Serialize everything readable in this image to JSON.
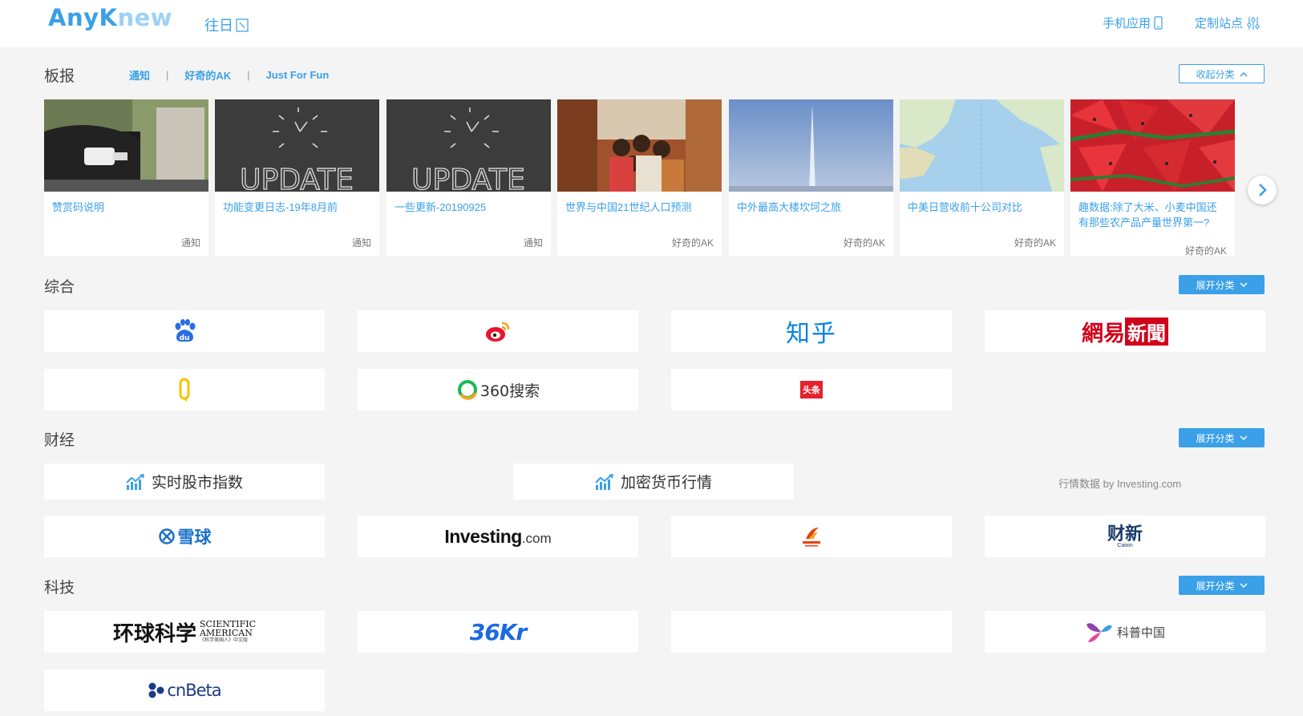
{
  "header": {
    "logo_any": "Any",
    "logo_k": "K",
    "logo_new": "new",
    "history_label": "往日",
    "mobile_label": "手机应用",
    "custom_label": "定制站点"
  },
  "board": {
    "title": "板报",
    "cats": [
      "通知",
      "好奇的AK",
      "Just For Fun"
    ],
    "separator": "|",
    "collapse_label": "收起分类",
    "cards": [
      {
        "title": "赞赏码说明",
        "tag": "通知"
      },
      {
        "title": "功能变更日志-19年8月前",
        "tag": "通知"
      },
      {
        "title": "一些更新-20190925",
        "tag": "通知"
      },
      {
        "title": "世界与中国21世纪人口预测",
        "tag": "好奇的AK"
      },
      {
        "title": "中外最高大楼坎坷之旅",
        "tag": "好奇的AK"
      },
      {
        "title": "中美日营收前十公司对比",
        "tag": "好奇的AK"
      },
      {
        "title": "趣数据:除了大米、小麦中国还有那些农产品产量世界第一?",
        "tag": "好奇的AK"
      }
    ],
    "update_text": "UPDATE"
  },
  "general": {
    "title": "综合",
    "expand_label": "展开分类",
    "zhihu": "知乎",
    "netease_a": "網易",
    "netease_b": "新聞",
    "so360": "360搜索",
    "toutiao": "头条"
  },
  "finance": {
    "title": "财经",
    "expand_label": "展开分类",
    "stock_label": "实时股市指数",
    "crypto_label": "加密货币行情",
    "data_note": "行情数据 by Investing.com",
    "xueqiu": "雪球",
    "investing_a": "Investing",
    "investing_b": ".com",
    "caixin": "财新",
    "caixin_sub": "Caixin"
  },
  "tech": {
    "title": "科技",
    "expand_label": "展开分类",
    "sciam_cn": "环球科学",
    "sciam_en1": "SCIENTIFIC",
    "sciam_en2": "AMERICAN",
    "sciam_sub": "《科学美国人》中文版",
    "kr36": "36Kr",
    "kepu": "科普中国",
    "cnbeta": "cnBeta"
  },
  "colors": {
    "accent": "#3aa0e8",
    "netease_red": "#d0021b",
    "bg": "#f4f4f4"
  }
}
